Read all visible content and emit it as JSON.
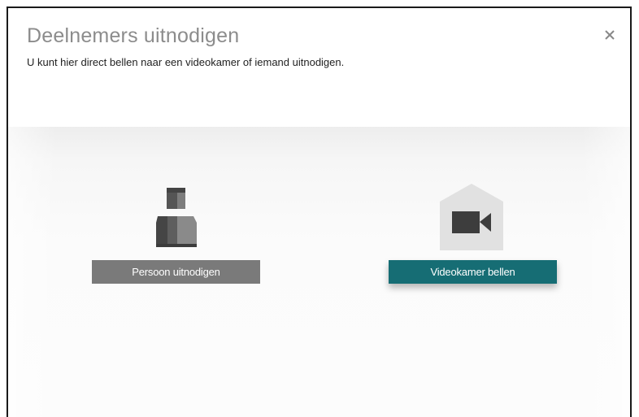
{
  "dialog": {
    "title": "Deelnemers uitnodigen",
    "subtitle": "U kunt hier direct bellen naar een videokamer of iemand uitnodigen.",
    "close_icon": "close-icon",
    "close_label": "×"
  },
  "options": {
    "person": {
      "icon": "person-icon",
      "button_label": "Persoon uitnodigen",
      "button_color": "#7a7a7a"
    },
    "room": {
      "icon": "video-camera-icon",
      "button_label": "Videokamer bellen",
      "button_color": "#166d74"
    }
  },
  "colors": {
    "title": "#8c8c8c",
    "accent": "#166d74",
    "icon_dark": "#4a4a4a"
  }
}
